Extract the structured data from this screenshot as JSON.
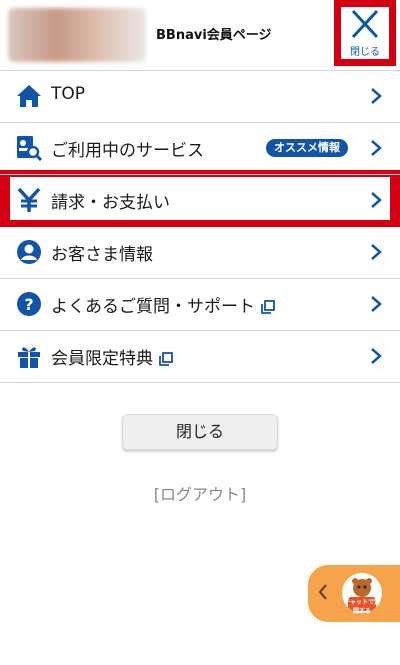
{
  "header": {
    "title": "BBnavi会員ページ",
    "close_label": "閉じる"
  },
  "menu": {
    "items": [
      {
        "label": "TOP"
      },
      {
        "label": "ご利用中のサービス",
        "badge": "オススメ情報"
      },
      {
        "label": "請求・お支払い"
      },
      {
        "label": "お客さま情報"
      },
      {
        "label": "よくあるご質問・サポート"
      },
      {
        "label": "会員限定特典"
      }
    ]
  },
  "footer": {
    "close_button": "閉じる",
    "logout": "[ログアウト]"
  },
  "chat": {
    "text": "チャットで質問する"
  },
  "colors": {
    "accent": "#1255a8",
    "highlight": "#d40012",
    "chat": "#f7a34b"
  }
}
